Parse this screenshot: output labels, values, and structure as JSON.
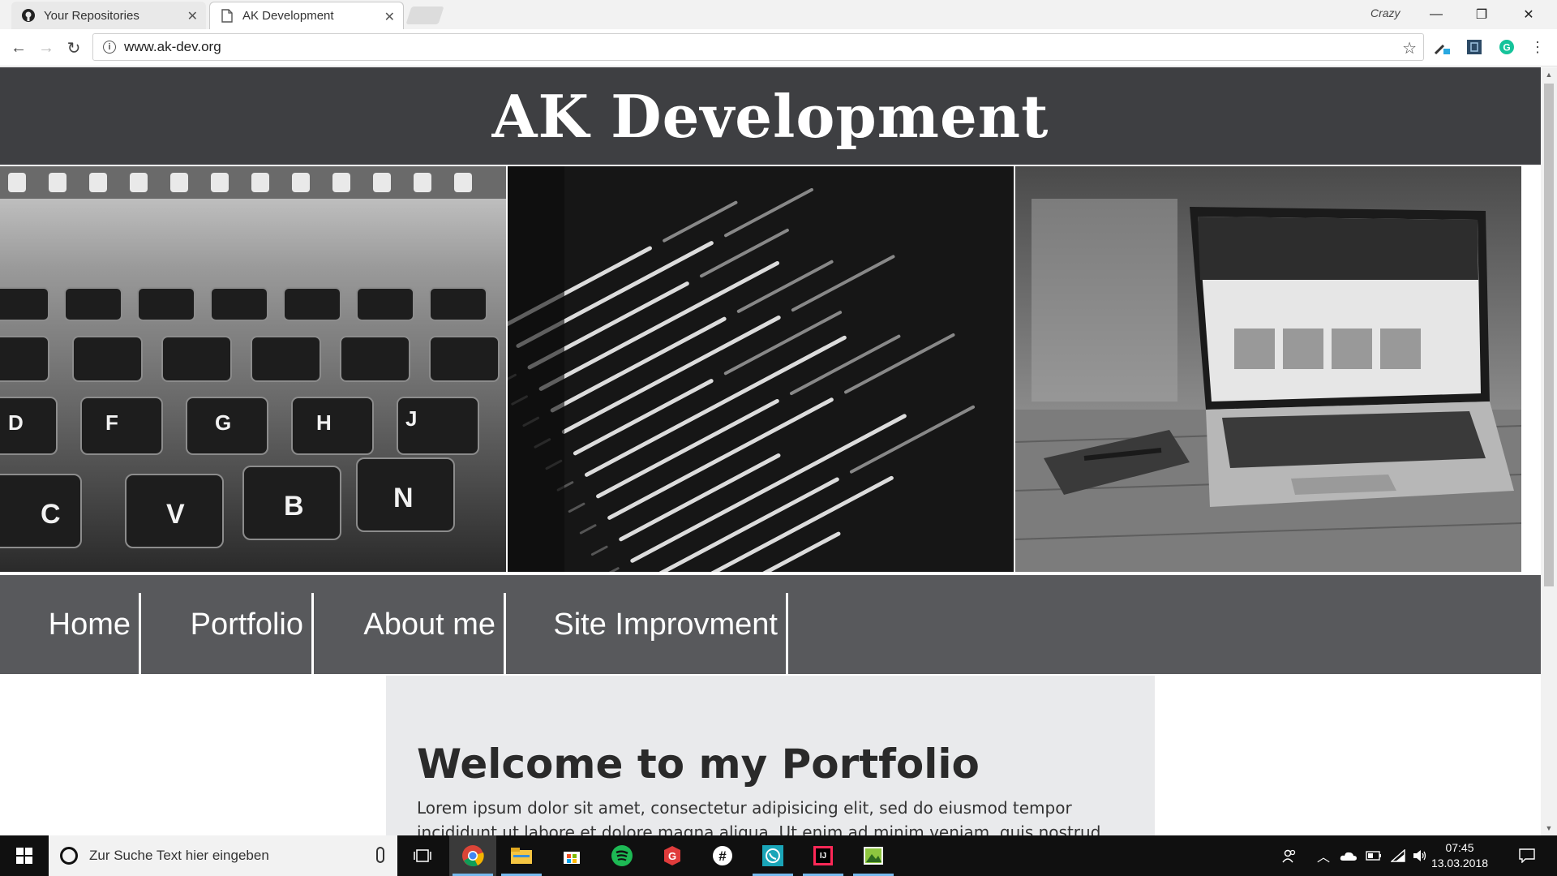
{
  "browser": {
    "tabs": [
      {
        "title": "Your Repositories",
        "active": false,
        "icon": "github-icon"
      },
      {
        "title": "AK Development",
        "active": true,
        "icon": "page-icon"
      }
    ],
    "profile_name": "Crazy",
    "url": "www.ak-dev.org"
  },
  "site": {
    "title": "AK Development",
    "gallery": [
      {
        "icon": "keyboard-photo"
      },
      {
        "icon": "code-photo"
      },
      {
        "icon": "laptop-photo"
      }
    ],
    "nav": [
      "Home",
      "Portfolio",
      "About me",
      "Site Improvment"
    ],
    "welcome_title": "Welcome to my Portfolio",
    "welcome_text": "Lorem ipsum dolor sit amet, consectetur adipisicing elit, sed do eiusmod tempor incididunt ut labore et dolore magna aliqua. Ut enim ad minim veniam, quis nostrud exercitation ullamco"
  },
  "taskbar": {
    "search_placeholder": "Zur Suche Text hier eingeben",
    "time": "07:45",
    "date": "13.03.2018",
    "apps": [
      "task-view-icon",
      "chrome-icon",
      "file-explorer-icon",
      "store-icon",
      "spotify-icon",
      "grammarly-icon",
      "slack-icon",
      "whatsapp-icon",
      "intellij-icon",
      "image-viewer-icon"
    ]
  },
  "colors": {
    "header_bg": "#3e3f42",
    "nav_bg": "#58595c",
    "card_bg": "#e9eaec"
  }
}
